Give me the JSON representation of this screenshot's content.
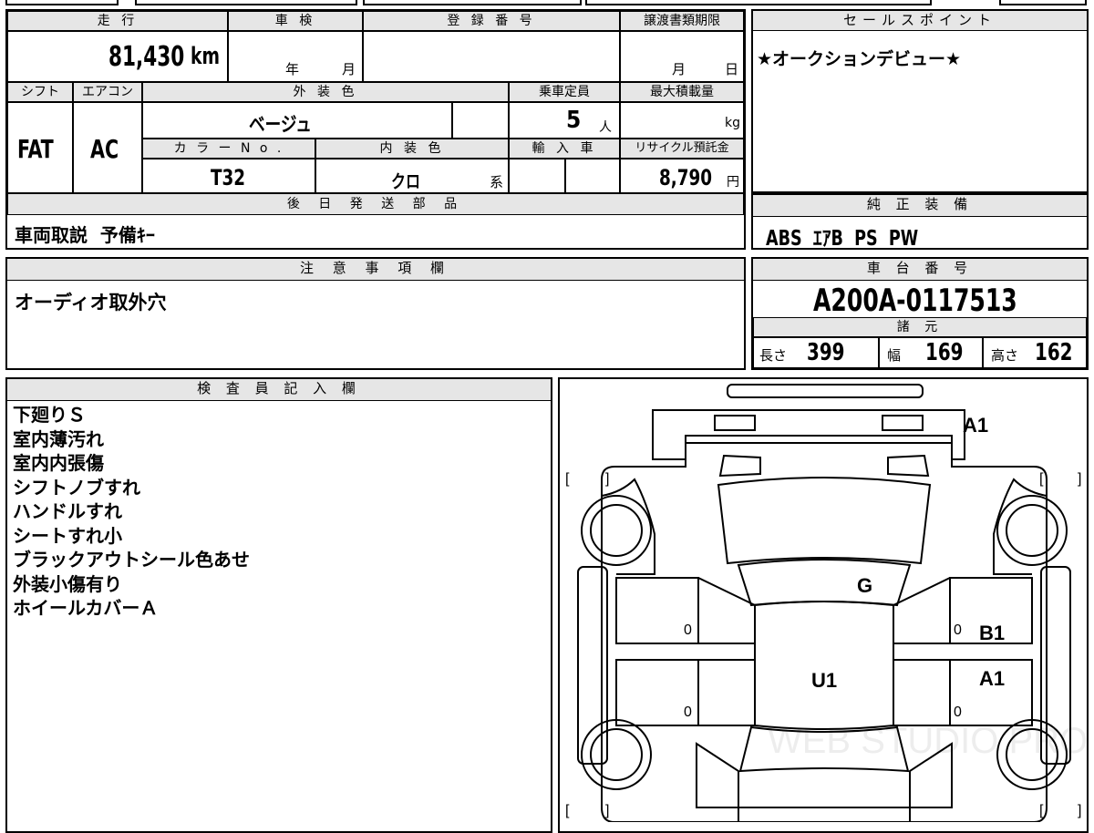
{
  "vehicle": {
    "mileage_label": "走 行",
    "mileage_value": "81,430",
    "mileage_unit": "km",
    "inspection_label": "車 検",
    "year_suffix": "年",
    "month_suffix": "月",
    "registration_label": "登 録 番 号",
    "transfer_deadline_label": "譲渡書類期限",
    "day_suffix": "日",
    "shift_label": "シフト",
    "aircon_label": "エアコン",
    "exterior_color_label": "外 装 色",
    "capacity_label": "乗車定員",
    "max_load_label": "最大積載量",
    "shift_value": "FAT",
    "aircon_value": "AC",
    "exterior_color_value": "ベージュ",
    "capacity_value": "5",
    "capacity_unit": "人",
    "load_unit": "kg",
    "color_no_label": "カ ラ ー  N o .",
    "interior_color_label": "内 装 色",
    "import_label": "輸 入 車",
    "recycle_label": "リサイクル預託金",
    "color_no_value": "T32",
    "interior_color_value": "クロ",
    "interior_color_suffix": "系",
    "recycle_value": "8,790",
    "recycle_unit": "円",
    "later_parts_label": "後 日 発 送 部 品",
    "later_parts_value": "車両取説  予備ｷｰ"
  },
  "sales": {
    "label": "セールスポイント",
    "value": "★オークションデビュー★"
  },
  "equipment": {
    "label": "純 正 装 備",
    "value": "ABS  ｴｱB  PS  PW"
  },
  "notes": {
    "label": "注 意 事 項 欄",
    "value": "オーディオ取外穴"
  },
  "chassis": {
    "label": "車 台 番 号",
    "value": "A200A-0117513",
    "specs_label": "諸 元",
    "length_label": "長さ",
    "length_value": "399",
    "width_label": "幅",
    "width_value": "169",
    "height_label": "高さ",
    "height_value": "162"
  },
  "inspector": {
    "label": "検 査 員 記 入 欄",
    "lines": [
      "下廻りＳ",
      "室内薄汚れ",
      "室内内張傷",
      "シフトノブすれ",
      "ハンドルすれ",
      "シートすれ小",
      "ブラックアウトシール色あせ",
      "外装小傷有り",
      "ホイールカバーＡ"
    ]
  },
  "diagram": {
    "marks": {
      "front_right": "A1",
      "hood": "G",
      "roof": "U1",
      "right_front_door": "B1",
      "right_rear_door": "A1"
    },
    "zero": "0",
    "bracket_open": "[",
    "bracket_close": "]",
    "watermark": "WEB STUDIO PRO"
  }
}
